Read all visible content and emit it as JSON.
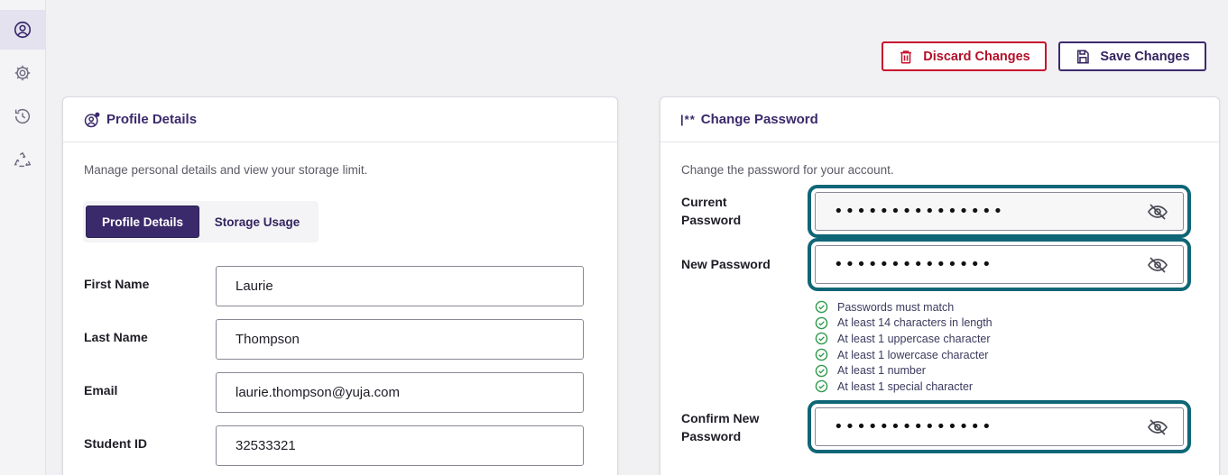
{
  "sidebar": {
    "items": [
      {
        "icon": "user-circle-icon",
        "active": true
      },
      {
        "icon": "gear-icon",
        "active": false
      },
      {
        "icon": "history-icon",
        "active": false
      },
      {
        "icon": "recycle-icon",
        "active": false
      }
    ]
  },
  "actions": {
    "discard_label": "Discard Changes",
    "save_label": "Save Changes"
  },
  "profile": {
    "title": "Profile Details",
    "description": "Manage personal details and view your storage limit.",
    "tabs": [
      {
        "label": "Profile Details",
        "selected": true
      },
      {
        "label": "Storage Usage",
        "selected": false
      }
    ],
    "fields": [
      {
        "label": "First Name",
        "value": "Laurie"
      },
      {
        "label": "Last Name",
        "value": "Thompson"
      },
      {
        "label": "Email",
        "value": "laurie.thompson@yuja.com"
      },
      {
        "label": "Student ID",
        "value": "32533321"
      }
    ]
  },
  "password": {
    "title_prefix": "|**",
    "title": "Change Password",
    "description": "Change the password for your account.",
    "current": {
      "label_line1": "Current",
      "label_line2": "Password",
      "masked": "•••••••••••••••"
    },
    "new": {
      "label": "New Password",
      "masked": "••••••••••••••"
    },
    "confirm": {
      "label_line1": "Confirm New",
      "label_line2": "Password",
      "masked": "••••••••••••••"
    },
    "requirements": [
      "Passwords must match",
      "At least 14 characters in length",
      "At least 1 uppercase character",
      "At least 1 lowercase character",
      "At least 1 number",
      "At least 1 special character"
    ]
  },
  "colors": {
    "brand": "#3a2a6b",
    "danger": "#c8102e",
    "focus_ring": "#0f6676",
    "success": "#2e9a4a"
  }
}
